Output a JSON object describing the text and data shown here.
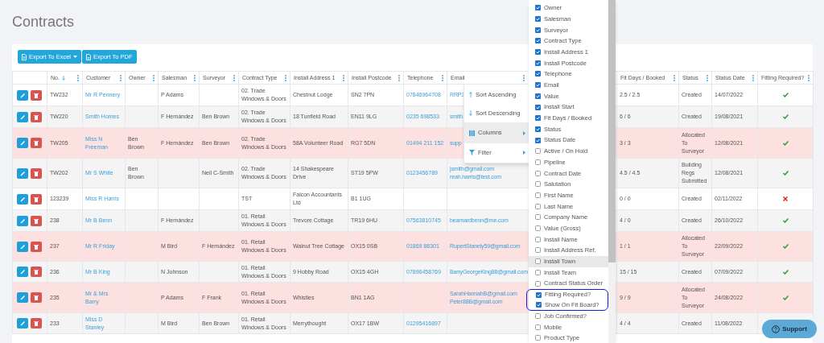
{
  "page_title": "Contracts",
  "toolbar": [
    {
      "label": "Export To Excel",
      "kind": "excel",
      "dropdown": true
    },
    {
      "label": "Export To PDF",
      "kind": "pdf",
      "dropdown": false
    }
  ],
  "table": {
    "columns": [
      {
        "label": "No.",
        "sorted": true
      },
      {
        "label": "Customer",
        "sorted": false
      },
      {
        "label": "Owner",
        "sorted": false
      },
      {
        "label": "Salesman",
        "sorted": false
      },
      {
        "label": "Surveyor",
        "sorted": false
      },
      {
        "label": "Contract Type",
        "sorted": false
      },
      {
        "label": "Install Address 1",
        "sorted": false
      },
      {
        "label": "Install Postcode",
        "sorted": false
      },
      {
        "label": "Telephone",
        "sorted": false
      },
      {
        "label": "Email",
        "sorted": false
      },
      {
        "label": "Fit Days / Booked",
        "sorted": false
      },
      {
        "label": "Status",
        "sorted": false
      },
      {
        "label": "Status Date",
        "sorted": false
      },
      {
        "label": "Fitting Required?",
        "sorted": false
      }
    ],
    "rows": [
      {
        "flagged": false,
        "no": "TW232",
        "customer": "Mr R Pennery",
        "salesman": "P Adams",
        "contract_type": "02. Trade Windows & Doors",
        "install_address_1": "Chestnut Lodge",
        "install_postcode": "SN2 7PN",
        "telephone": "07846964708",
        "email": [
          "RRP3"
        ],
        "fit_days_booked": "2.5 / 2.5",
        "status": "Created",
        "status_date": "14/07/2022",
        "fitting_required": true
      },
      {
        "flagged": false,
        "no": "TW220",
        "customer": "Smith Homes",
        "salesman": "F Hernández",
        "surveyor": "Ben Brown",
        "contract_type": "02. Trade Windows & Doors",
        "install_address_1": "18 Tunfield Road",
        "install_postcode": "EN11 9LG",
        "telephone": "0235 698533",
        "email": [
          "smith"
        ],
        "fit_days_booked": "6 / 6",
        "status": "Created",
        "status_date": "19/08/2021",
        "fitting_required": true
      },
      {
        "flagged": true,
        "no": "TW205",
        "customer": "Miss N Freeman",
        "owner": "Ben Brown",
        "salesman": "F Hernández",
        "surveyor": "Ben Brown",
        "contract_type": "02. Trade Windows & Doors",
        "install_address_1": "58A Volunteer Road",
        "install_postcode": "RG7 5DN",
        "telephone": "01494 211 152",
        "email": [
          "supp"
        ],
        "fit_days_booked": "3 / 3",
        "status": "Allocated To Surveyor",
        "status_date": "12/08/2021",
        "fitting_required": true
      },
      {
        "flagged": false,
        "no": "TW202",
        "customer": "Mr S White",
        "owner": "Ben Brown",
        "surveyor": "Neil C-Smith",
        "contract_type": "02. Trade Windows & Doors",
        "install_address_1": "14 Shakespeare Drive",
        "install_postcode": "ST19 5PW",
        "telephone": "0123456789",
        "email": [
          "jsmith@gmail.com",
          "reah.harris@test.com"
        ],
        "fit_days_booked": "4.5 / 4.5",
        "status": "Building Regs Submitted",
        "status_date": "12/08/2021",
        "fitting_required": true
      },
      {
        "flagged": false,
        "no": "123239",
        "customer": "Miss R Harris",
        "contract_type": "TST",
        "install_address_1": "Falcon Accountants Ltd",
        "install_postcode": "B1 1UG",
        "fit_days_booked": "0 / 0",
        "status": "Created",
        "status_date": "02/11/2022",
        "fitting_required": false
      },
      {
        "flagged": false,
        "no": "238",
        "customer": "Mr B Benn",
        "salesman": "F Hernández",
        "contract_type": "01. Retail Windows & Doors",
        "install_address_1": "Trevore Cottage",
        "install_postcode": "TR19 6HU",
        "telephone": "07563810745",
        "email": [
          "bearnardbenn@me.com"
        ],
        "fit_days_booked": "4 / 0",
        "status": "Created",
        "status_date": "26/10/2022",
        "fitting_required": true
      },
      {
        "flagged": true,
        "no": "237",
        "customer": "Mr R Friday",
        "salesman": "M Bird",
        "surveyor": "F Hernández",
        "contract_type": "01. Retail Windows & Doors",
        "install_address_1": "Walnut Tree Cottage",
        "install_postcode": "OX15 0SB",
        "telephone": "01869 88301",
        "email": [
          "RupertStanely59@gmail.com"
        ],
        "fit_days_booked": "1 / 1",
        "status": "Allocated To Surveyor",
        "status_date": "22/09/2022",
        "fitting_required": true
      },
      {
        "flagged": false,
        "no": "236",
        "customer": "Mr B King",
        "salesman": "N Johnson",
        "contract_type": "01. Retail Windows & Doors",
        "install_address_1": "9 Hobby Road",
        "install_postcode": "OX15 4GH",
        "telephone": "07896458769",
        "email": [
          "BarryGeorgeKing88@gmail.com"
        ],
        "fit_days_booked": "15 / 15",
        "status": "Created",
        "status_date": "07/09/2022",
        "fitting_required": true
      },
      {
        "flagged": true,
        "no": "235",
        "customer": "Mr & Mrs Barry",
        "salesman": "P Adams",
        "surveyor": "F Frank",
        "contract_type": "01. Retail Windows & Doors",
        "install_address_1": "Whistles",
        "install_postcode": "BN1 1AG",
        "email": [
          "SarahHannahB@gmail.com",
          "Peter88B@gmail.com"
        ],
        "fit_days_booked": "9 / 9",
        "status": "Allocated To Surveyor",
        "status_date": "24/08/2022",
        "fitting_required": true
      },
      {
        "flagged": false,
        "no": "233",
        "customer": "Miss D Stanley",
        "salesman": "M Bird",
        "surveyor": "Ben Brown",
        "contract_type": "01. Retail Windows & Doors",
        "install_address_1": "Merrythought",
        "install_postcode": "OX17 1BW",
        "telephone": "01295416897",
        "fit_days_booked": "4 / 4",
        "status": "Created",
        "status_date": "11/08/2022"
      }
    ]
  },
  "column_menu": [
    {
      "label": "Sort Ascending",
      "kind": "sort_asc",
      "submenu": false,
      "highlighted": false
    },
    {
      "label": "Sort Descending",
      "kind": "sort_desc",
      "submenu": false,
      "highlighted": false
    },
    {
      "label": "Columns",
      "kind": "columns",
      "submenu": true,
      "highlighted": true
    },
    {
      "label": "Filter",
      "kind": "filter",
      "submenu": true,
      "highlighted": false
    }
  ],
  "column_chooser": [
    {
      "label": "Owner",
      "checked": true,
      "highlighted": false,
      "outlined": false
    },
    {
      "label": "Salesman",
      "checked": true,
      "highlighted": false,
      "outlined": false
    },
    {
      "label": "Surveyor",
      "checked": true,
      "highlighted": false,
      "outlined": false
    },
    {
      "label": "Contract Type",
      "checked": true,
      "highlighted": false,
      "outlined": false
    },
    {
      "label": "Install Address 1",
      "checked": true,
      "highlighted": false,
      "outlined": false
    },
    {
      "label": "Install Postcode",
      "checked": true,
      "highlighted": false,
      "outlined": false
    },
    {
      "label": "Telephone",
      "checked": true,
      "highlighted": false,
      "outlined": false
    },
    {
      "label": "Email",
      "checked": true,
      "highlighted": false,
      "outlined": false
    },
    {
      "label": "Value",
      "checked": true,
      "highlighted": false,
      "outlined": false
    },
    {
      "label": "Install Start",
      "checked": true,
      "highlighted": false,
      "outlined": false
    },
    {
      "label": "Fit Days / Booked",
      "checked": true,
      "highlighted": false,
      "outlined": false
    },
    {
      "label": "Status",
      "checked": true,
      "highlighted": false,
      "outlined": false
    },
    {
      "label": "Status Date",
      "checked": true,
      "highlighted": false,
      "outlined": false
    },
    {
      "label": "Active / On Hold",
      "checked": false,
      "highlighted": false,
      "outlined": false
    },
    {
      "label": "Pipeline",
      "checked": false,
      "highlighted": false,
      "outlined": false
    },
    {
      "label": "Contract Date",
      "checked": false,
      "highlighted": false,
      "outlined": false
    },
    {
      "label": "Salutation",
      "checked": false,
      "highlighted": false,
      "outlined": false
    },
    {
      "label": "First Name",
      "checked": false,
      "highlighted": false,
      "outlined": false
    },
    {
      "label": "Last Name",
      "checked": false,
      "highlighted": false,
      "outlined": false
    },
    {
      "label": "Company Name",
      "checked": false,
      "highlighted": false,
      "outlined": false
    },
    {
      "label": "Value (Gross)",
      "checked": false,
      "highlighted": false,
      "outlined": false
    },
    {
      "label": "Install Name",
      "checked": false,
      "highlighted": false,
      "outlined": false
    },
    {
      "label": "Install Address Ref.",
      "checked": false,
      "highlighted": false,
      "outlined": false
    },
    {
      "label": "Install Town",
      "checked": false,
      "highlighted": true,
      "outlined": false
    },
    {
      "label": "Install Team",
      "checked": false,
      "highlighted": false,
      "outlined": false
    },
    {
      "label": "Contract Status Order",
      "checked": false,
      "highlighted": false,
      "outlined": false
    },
    {
      "label": "Fitting Required?",
      "checked": true,
      "highlighted": false,
      "outlined": true
    },
    {
      "label": "Show On Fit Board?",
      "checked": true,
      "highlighted": false,
      "outlined": true
    },
    {
      "label": "Job Confirmed?",
      "checked": false,
      "highlighted": false,
      "outlined": false
    },
    {
      "label": "Mobile",
      "checked": false,
      "highlighted": false,
      "outlined": false
    },
    {
      "label": "Product Type",
      "checked": false,
      "highlighted": false,
      "outlined": false
    }
  ],
  "support_button": {
    "label": "Support"
  }
}
